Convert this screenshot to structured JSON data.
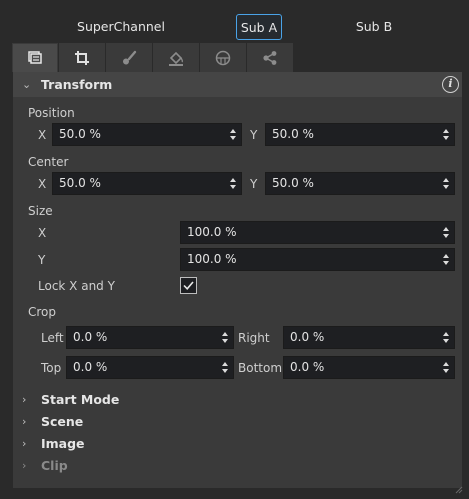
{
  "channels": {
    "super": "SuperChannel",
    "sub_a": "Sub A",
    "sub_b": "Sub B",
    "selected": "Sub A"
  },
  "tabs": [
    {
      "icon": "stack-icon",
      "active": true
    },
    {
      "icon": "crop-icon",
      "active": false
    },
    {
      "icon": "brush-icon",
      "active": false
    },
    {
      "icon": "fill-icon",
      "active": false
    },
    {
      "icon": "ball-icon",
      "active": false
    },
    {
      "icon": "nodes-icon",
      "active": false
    }
  ],
  "transform": {
    "title": "Transform",
    "position": {
      "label": "Position",
      "x_label": "X",
      "x_value": "50.0 %",
      "y_label": "Y",
      "y_value": "50.0 %"
    },
    "center": {
      "label": "Center",
      "x_label": "X",
      "x_value": "50.0 %",
      "y_label": "Y",
      "y_value": "50.0 %"
    },
    "size": {
      "label": "Size",
      "x_label": "X",
      "x_value": "100.0 %",
      "y_label": "Y",
      "y_value": "100.0 %"
    },
    "lock": {
      "label": "Lock X and Y",
      "checked": true
    },
    "crop": {
      "label": "Crop",
      "left_label": "Left",
      "left_value": "0.0 %",
      "right_label": "Right",
      "right_value": "0.0 %",
      "top_label": "Top",
      "top_value": "0.0 %",
      "bottom_label": "Bottom",
      "bottom_value": "0.0 %"
    }
  },
  "sections": {
    "start_mode": "Start Mode",
    "scene": "Scene",
    "image": "Image",
    "clip": "Clip"
  },
  "colors": {
    "accent": "#4aa3e8",
    "panel_bg": "#3a3a3a",
    "field_bg": "#1e1f22"
  }
}
